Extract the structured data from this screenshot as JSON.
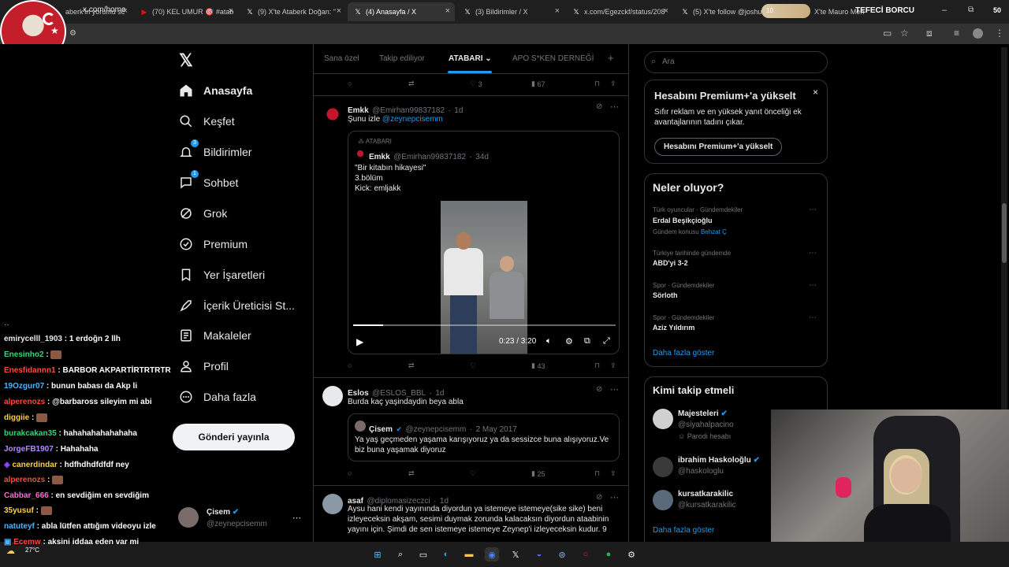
{
  "browser": {
    "tabs": [
      {
        "title": "aberk'in yorumu sc",
        "icon": "site-icon"
      },
      {
        "title": "(70) KEL UMUR 🎯 #atab",
        "icon": "youtube-icon"
      },
      {
        "title": "(9) X'te Ataberk Doğan: \"",
        "icon": "x-icon"
      },
      {
        "title": "(4) Anasayfa / X",
        "icon": "x-icon",
        "active": true
      },
      {
        "title": "(3) Bildirimler / X",
        "icon": "x-icon"
      },
      {
        "title": "x.com/Egezckf/status/208",
        "icon": "x-icon"
      },
      {
        "title": "(5) X'te follow @joshuax",
        "icon": "x-icon"
      },
      {
        "title": "X'te Mauro Men",
        "icon": "x-icon"
      }
    ],
    "url": "x.com/home",
    "overlay_pill": {
      "level": "10",
      "label": "TEFECİ BORCU",
      "value": "50"
    }
  },
  "nav": {
    "items": [
      {
        "label": "Anasayfa",
        "icon": "home-icon"
      },
      {
        "label": "Keşfet",
        "icon": "search-icon"
      },
      {
        "label": "Bildirimler",
        "icon": "bell-icon",
        "badge": "3"
      },
      {
        "label": "Sohbet",
        "icon": "chat-icon",
        "badge": "1"
      },
      {
        "label": "Grok",
        "icon": "grok-icon"
      },
      {
        "label": "Premium",
        "icon": "premium-icon"
      },
      {
        "label": "Yer İşaretleri",
        "icon": "bookmark-icon"
      },
      {
        "label": "İçerik Üreticisi St...",
        "icon": "rocket-icon"
      },
      {
        "label": "Makaleler",
        "icon": "article-icon"
      },
      {
        "label": "Profil",
        "icon": "profile-icon"
      },
      {
        "label": "Daha fazla",
        "icon": "more-icon"
      }
    ],
    "post_button": "Gönderi yayınla",
    "account": {
      "name": "Çisem",
      "handle": "@zeynepcisemm"
    }
  },
  "timeline": {
    "tabs": [
      "Sana özel",
      "Takip ediliyor",
      "ATABARI",
      "APO S*KEN DERNEĞİ"
    ],
    "top_actions": {
      "likes": "3",
      "views": "67"
    },
    "tweets": [
      {
        "name": "Emkk",
        "handle": "@Emirhan99837182",
        "time": "1d",
        "text": "Şunu izle",
        "mention": "@zeynepcisemm",
        "quote": {
          "community": "ATABARI",
          "name": "Emkk",
          "handle": "@Emirhan99837182",
          "time": "34d",
          "lines": [
            "\"Bir kitabın hikayesi\"",
            "3.bölüm",
            "Kick: emljakk"
          ],
          "video_time": "0:23 / 3:20",
          "progress": 0.115
        },
        "views": "43"
      },
      {
        "name": "Eslos",
        "handle": "@ESLOS_BBL",
        "time": "1d",
        "text": "Burda kaç yaşindaydin beya abla",
        "quote": {
          "name": "Çisem",
          "handle": "@zeynepcisemm",
          "time": "2 May 2017",
          "text": "Ya yaş geçmeden yaşama karışıyoruz ya da sessizce buna alışıyoruz.Ve biz buna yaşamak diyoruz"
        },
        "views": "25"
      },
      {
        "name": "asaf",
        "handle": "@diplomasizeczci",
        "time": "1d",
        "text": "Aysu hani kendi yayınında diyordun ya istemeye istemeye(sike sike) beni izleyeceksin akşam, sesimi duymak zorunda kalacaksın diyordun ataabinin yayını için. Şimdi de sen istemeye istemeye Zeynep'i izleyeceksin kudur. 9"
      }
    ]
  },
  "sidebar": {
    "search_placeholder": "Ara",
    "premium": {
      "title": "Hesabını Premium+'a yükselt",
      "text": "Sıfır reklam ve en yüksek yanıt önceliği ek avantajlarının tadını çıkar.",
      "button": "Hesabını Premium+'a yükselt"
    },
    "trends": {
      "title": "Neler oluyor?",
      "items": [
        {
          "category": "Türk oyuncular · Gündemdekiler",
          "name": "Erdal Beşikçioğlu",
          "extra_prefix": "Gündem konusu",
          "extra_link": "Behzat Ç"
        },
        {
          "category": "Türkiye tarihinde gündemde",
          "name": "ABD'yi 3-2"
        },
        {
          "category": "Spor · Gündemdekiler",
          "name": "Sörloth"
        },
        {
          "category": "Spor · Gündemdekiler",
          "name": "Aziz Yıldırım"
        }
      ],
      "more": "Daha fazla göster"
    },
    "follow": {
      "title": "Kimi takip etmeli",
      "items": [
        {
          "name": "Majesteleri",
          "handle": "@siyahalpacino",
          "note": "Parodi hesabı"
        },
        {
          "name": "ibrahim Haskoloğlu",
          "handle": "@haskologlu"
        },
        {
          "name": "kursatkarakilic",
          "handle": "@kursatkarakilic"
        }
      ],
      "more": "Daha fazla göster"
    }
  },
  "chat": [
    {
      "user": "emirycelll_1903",
      "color": "#e8e8e8",
      "msg": "1 erdoğn 2 llh"
    },
    {
      "user": "Enesinho2",
      "color": "#3cd27a",
      "msg": "",
      "emote": true
    },
    {
      "user": "Enesfidannn1",
      "color": "#ff4a3d",
      "msg": "BARBOR AKPARTİRTRTRTR"
    },
    {
      "user": "19Ozgur07",
      "color": "#4ab4ff",
      "msg": "bunun babası da Akp li"
    },
    {
      "user": "alperenozs",
      "color": "#ff4a3d",
      "msg": "@barbaross sileyim mi abi"
    },
    {
      "user": "diggiie",
      "color": "#f7d154",
      "msg": "",
      "emote": true
    },
    {
      "user": "burakcakan35",
      "color": "#3cd27a",
      "msg": "hahahahahahahaha"
    },
    {
      "user": "JorgeFB1907",
      "color": "#b48aff",
      "msg": "Hahahaha"
    },
    {
      "user": "canerdindar",
      "color": "#f7d154",
      "msg": "hdfhdhdfdfdf ney"
    },
    {
      "user": "alperenozs",
      "color": "#ff4a3d",
      "msg": "",
      "emote": true
    },
    {
      "user": "Cabbar_666",
      "color": "#ff6ad5",
      "msg": "en sevdiğim en sevdiğim"
    },
    {
      "user": "35yusuf",
      "color": "#f7d154",
      "msg": "",
      "emote": true
    },
    {
      "user": "natuteyf",
      "color": "#4ab4ff",
      "msg": "abla lütfen attığım videoyu izle"
    },
    {
      "user": "Ecemw",
      "color": "#ff4a3d",
      "msg": "aksini iddaa eden var mi"
    }
  ],
  "taskbar": {
    "weather": "27°C"
  },
  "colors": {
    "accent": "#1d9bf0",
    "background": "#000000",
    "border": "#2f3336",
    "muted": "#71767b"
  }
}
